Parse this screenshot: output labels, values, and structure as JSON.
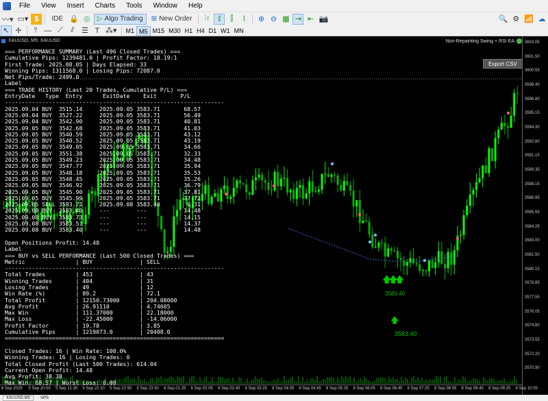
{
  "menu": [
    "File",
    "View",
    "Insert",
    "Charts",
    "Tools",
    "Window",
    "Help"
  ],
  "toolbar": {
    "ide_label": "IDE",
    "algo_trading_label": "Algo Trading",
    "new_order_label": "New Order"
  },
  "timeframes": [
    "M1",
    "M5",
    "M15",
    "M30",
    "H1",
    "H4",
    "D1",
    "W1",
    "MN"
  ],
  "active_timeframe": "M5",
  "chart": {
    "symbol": "XAUUSD, M5:  XAUUSD",
    "ea_name": "Non-Repainting Swing + RSI EA",
    "export_button": "Export CSV",
    "annotation_tp": "3583.40",
    "annotation_overlap": "3583.40",
    "price_labels": [
      "3603.05",
      "3601.50",
      "3600.55",
      "3598.40",
      "3596.80",
      "3595.15",
      "3594.30",
      "3592.60",
      "3591.15",
      "3589.35",
      "3588.15",
      "3586.95",
      "3585.55",
      "3584.25",
      "3583.00",
      "3581.50",
      "3580.15",
      "3578.85",
      "3577.55",
      "3576.05",
      "3574.80",
      "3573.55",
      "3572.20",
      "3570.90"
    ],
    "time_labels": [
      "8 Sep 2025",
      "5 Sep 20:50",
      "5 Sep 21:30",
      "5 Sep 22:10",
      "5 Sep 22:50",
      "5 Sep 23:30",
      "8 Sep 01:25",
      "8 Sep 02:05",
      "8 Sep 02:45",
      "8 Sep 03:25",
      "8 Sep 04:05",
      "8 Sep 04:45",
      "8 Sep 05:25",
      "8 Sep 06:05",
      "8 Sep 06:45",
      "8 Sep 07:25",
      "8 Sep 08:05",
      "8 Sep 08:45",
      "8 Sep 09:25",
      "8 Sep 10:05"
    ]
  },
  "colors": {
    "bull": "#00ff00",
    "bear": "#00b000",
    "annotation": "#00c800",
    "background": "#000000"
  },
  "info_lines": [
    "=== PERFORMANCE SUMMARY (Last 496 Closed Trades) ===",
    "Cumulative Pips: 1239481.0 | Profit Factor: 18.19:1",
    "First Trade: 2025.08.05 | Days Elapsed: 33",
    "Winning Pips: 1311568.0 | Losing Pips: 72087.0",
    "Net Pips/Trade: 2499.0",
    "Label",
    "=== TRADE HISTORY (Last 20 Trades, Cumulative P/L) ===",
    "EntryDate   Type  Entry      ExitDate    Exit       P/L",
    "-----------------------------------------------------------------",
    "2025.09.04 BUY  3515.14     2025.09.05 3583.71       68.57",
    "2025.09.04 BUY  3527.22     2025.09.05 3583.71       56.49",
    "2025.09.04 BUY  3542.90     2025.09.05 3583.71       40.81",
    "2025.09.05 BUY  3542.68     2025.09.05 3583.71       41.03",
    "2025.09.05 BUY  3540.59     2025.09.05 3583.71       43.12",
    "2025.09.05 BUY  3540.52     2025.09.05 3583.71       43.19",
    "2025.09.05 BUY  3549.05     2025.09.05 3583.71       34.66",
    "2025.09.05 BUY  3551.38     2025.09.05 3583.71       32.33",
    "2025.09.05 BUY  3549.23     2025.09.05 3583.71       34.48",
    "2025.09.05 BUY  3547.77     2025.09.05 3583.71       35.94",
    "2025.09.05 BUY  3548.18     2025.09.05 3583.71       35.53",
    "2025.09.05 BUY  3548.45     2025.09.05 3583.71       35.26",
    "2025.09.05 BUY  3546.92     2025.09.05 3583.71       36.79",
    "2025.09.05 BUY  3545.90     2025.09.05 3583.71       37.81",
    "2025.09.05 BUY  3545.99     2025.09.05 3583.71       37.72",
    "2025.09.05 SELL 3583.71     2025.09.08 3583.40        0.31",
    "2025.09.08 BUY  3583.40     ---        ---           14.48",
    "2025.09.08 BUY  3583.73     ---        ---           14.15",
    "2025.09.08 BUY  3583.51     ---        ---           14.37",
    "2025.09.08 BUY  3583.40     ---        ---           14.48",
    "",
    "Open Positions Profit: 14.48",
    "Label",
    "=== BUY vs SELL PERFORMANCE (Last 500 Closed Trades) ===",
    "Metric               | BUY              | SELL",
    "-----------------------------------------------------------------",
    "Total Trades         | 453              | 43",
    "Winning Trades       | 404              | 31",
    "Losing Trades        | 49               | 12",
    "Win Rate (%)         | 89.2             | 72.1",
    "Total Profit         | 12150.73000      | 204.08000",
    "Avg Profit           | 26.91110         | 4.74605",
    "Max Win              | 111.37000        | 22.18000",
    "Max Loss             | -22.45000        | -14.06000",
    "Profit Factor        | 19.78            | 3.85",
    "Cumulative Pips      | 1219073.0        | 20408.0",
    "=================================================================",
    "",
    "Closed Trades: 16 | Win Rate: 100.0%",
    "Winning Trades: 16 | Losing Trades: 0",
    "Total Closed Profit (Last 500 Trades): 614.04",
    "Current Open Profit: 14.48",
    "Avg Profit: 38.38",
    "Max Win: 68.57 | Worst Loss: 0.00"
  ],
  "status": {
    "tab": "XAUUSD,M5",
    "tab2": "VPS"
  }
}
